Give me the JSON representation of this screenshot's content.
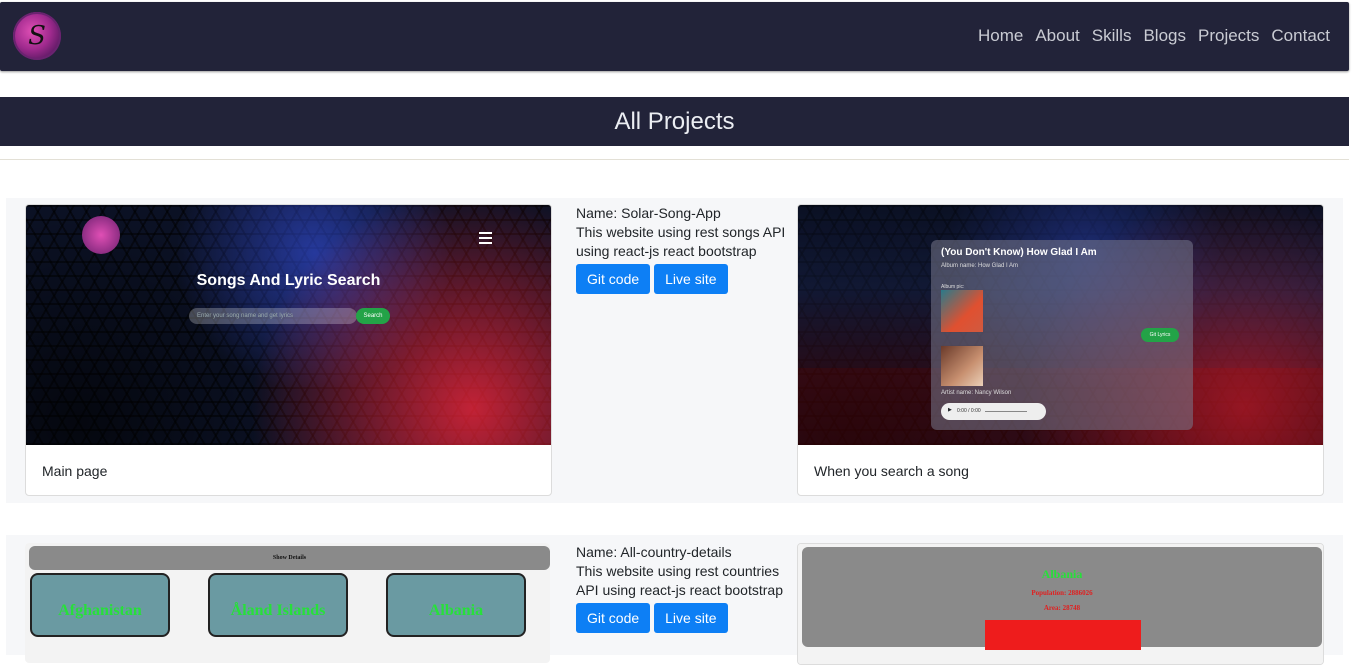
{
  "nav": {
    "logo_text": "S",
    "items": [
      "Home",
      "About",
      "Skills",
      "Blogs",
      "Projects",
      "Contact"
    ]
  },
  "page_title": "All Projects",
  "projects": [
    {
      "name": "Name: Solar-Song-App",
      "description": "This website using rest songs API using react-js react bootstrap",
      "git_label": "Git code",
      "live_label": "Live site",
      "left_caption": "Main page",
      "right_caption": "When you search a song",
      "left_shot": {
        "title": "Songs And Lyric Search",
        "search_placeholder": "Enter your song name and get lyrics",
        "search_button": "Search"
      },
      "right_shot": {
        "song_title": "(You Don't Know) How Glad I Am",
        "album": "Album name: How Glad I Am",
        "album_pic": "Album pic:",
        "artist": "Artist name: Nancy Wilson",
        "lyrics_button": "Git Lyrics",
        "audio_time": "0:00 / 0:00"
      }
    },
    {
      "name": "Name: All-country-details",
      "description": "This website using rest countries API using react-js react bootstrap",
      "git_label": "Git code",
      "live_label": "Live site",
      "left_shot": {
        "bar_label": "Show Details",
        "countries": [
          "Afghanistan",
          "Åland Islands",
          "Albania"
        ]
      },
      "right_shot": {
        "country": "Albania",
        "population": "Population: 2886026",
        "area": "Area: 28748"
      }
    }
  ],
  "colors": {
    "navbar_bg": "#222339",
    "button_bg": "#0d7ff5",
    "row_bg": "#f6f7f9"
  }
}
